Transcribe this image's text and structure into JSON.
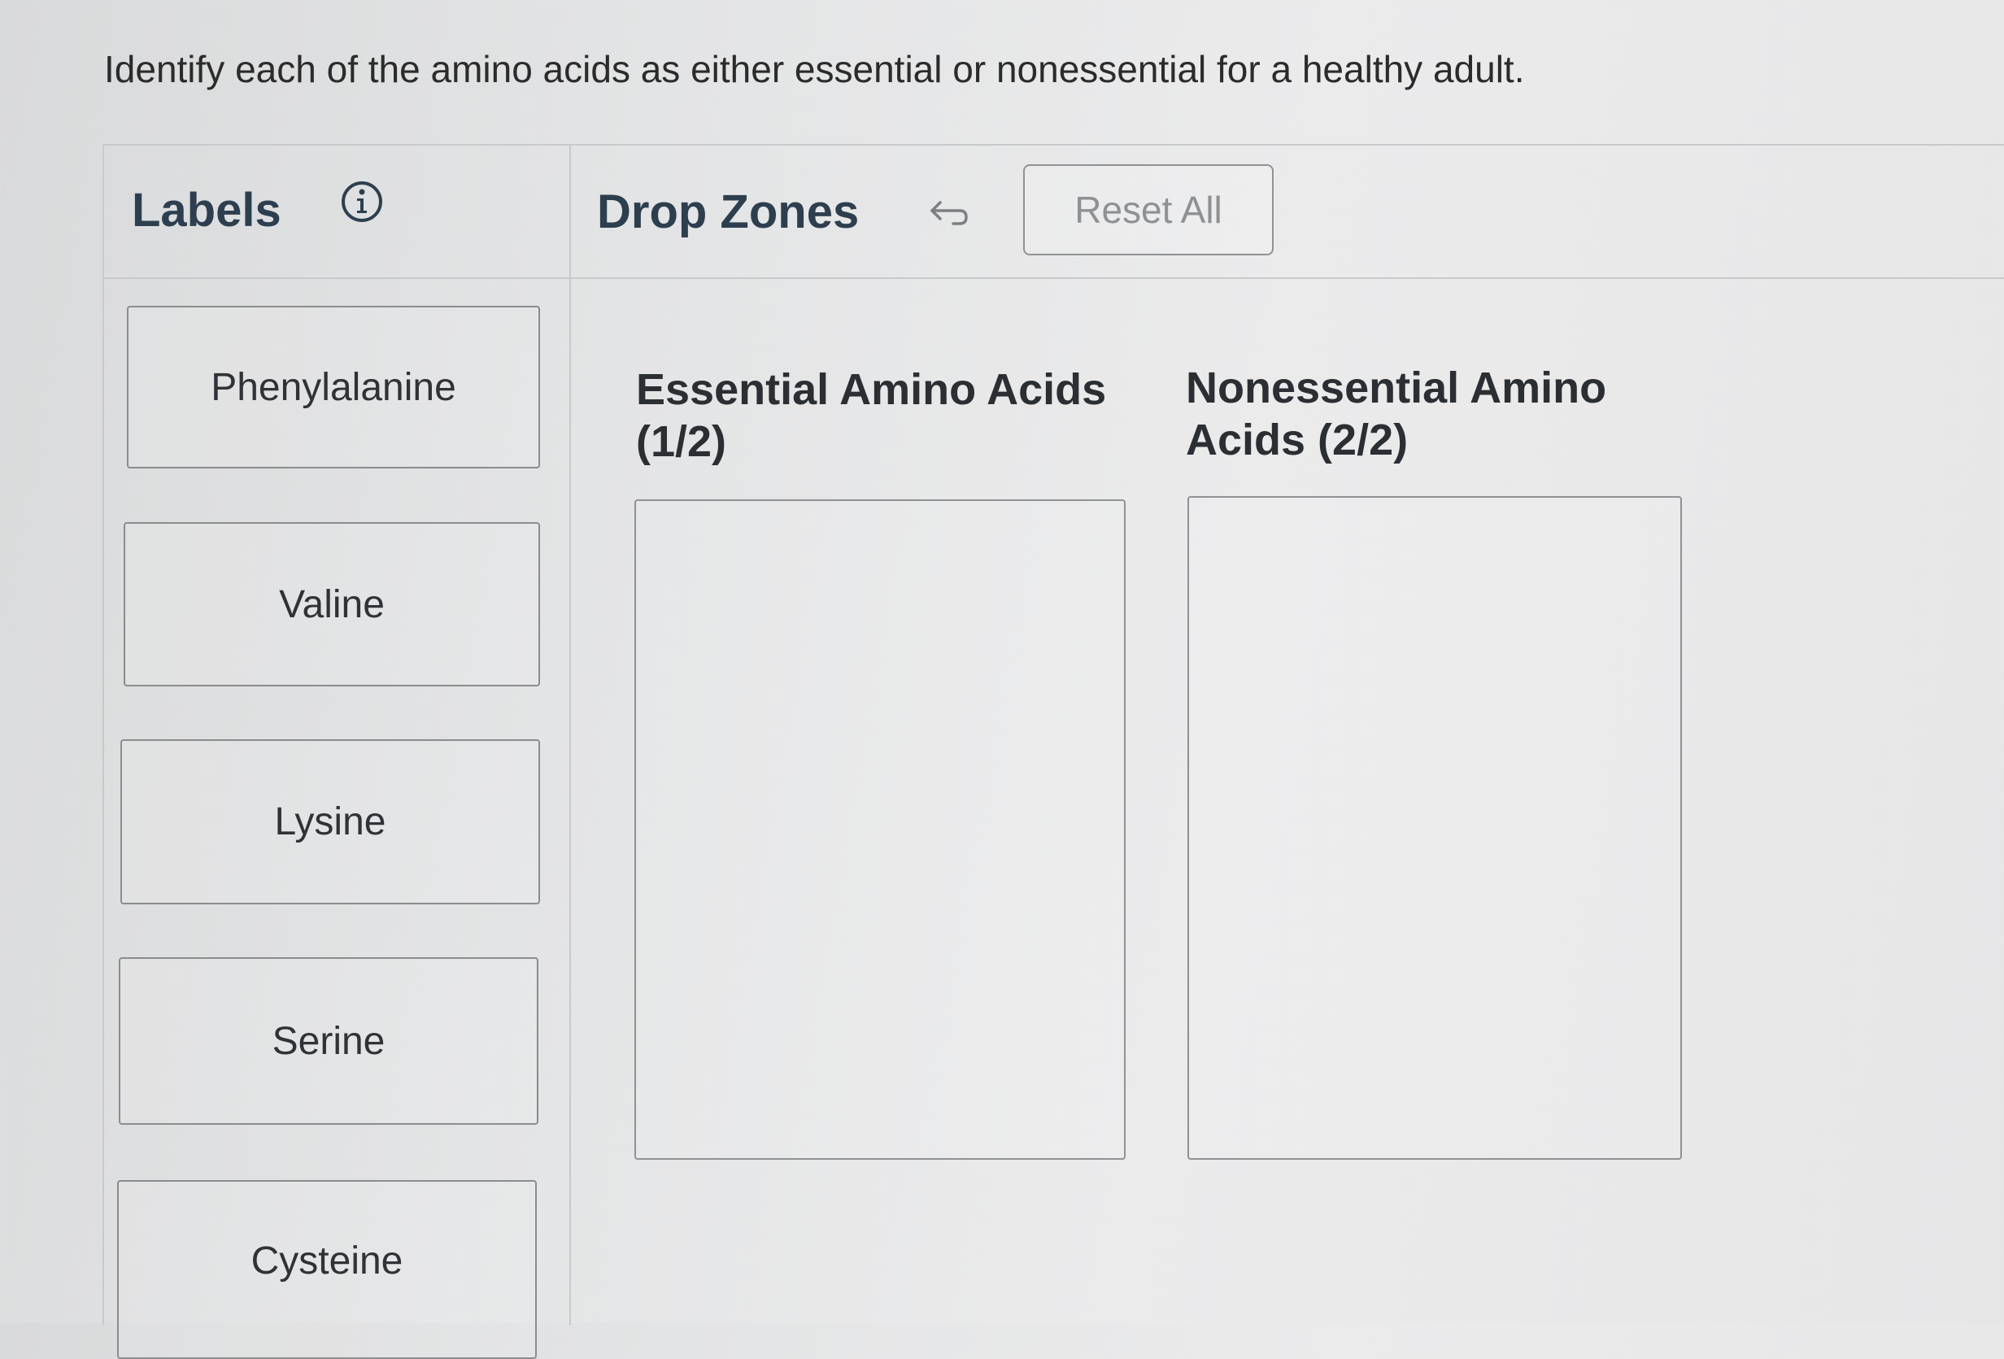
{
  "prompt": "Identify each of the amino acids as either essential or nonessential for a healthy adult.",
  "labels_panel": {
    "title": "Labels",
    "info_icon": "info-circle-icon",
    "items": [
      {
        "label": "Phenylalanine"
      },
      {
        "label": "Valine"
      },
      {
        "label": "Lysine"
      },
      {
        "label": "Serine"
      },
      {
        "label": "Cysteine"
      }
    ]
  },
  "drop_zones_panel": {
    "title": "Drop Zones",
    "undo_icon": "undo-arrow-icon",
    "reset_label": "Reset All",
    "zones": [
      {
        "heading_line1": "Essential Amino Acids",
        "heading_line2": "(1/2)"
      },
      {
        "heading_line1": "Nonessential Amino",
        "heading_line2": "Acids (2/2)"
      }
    ]
  }
}
